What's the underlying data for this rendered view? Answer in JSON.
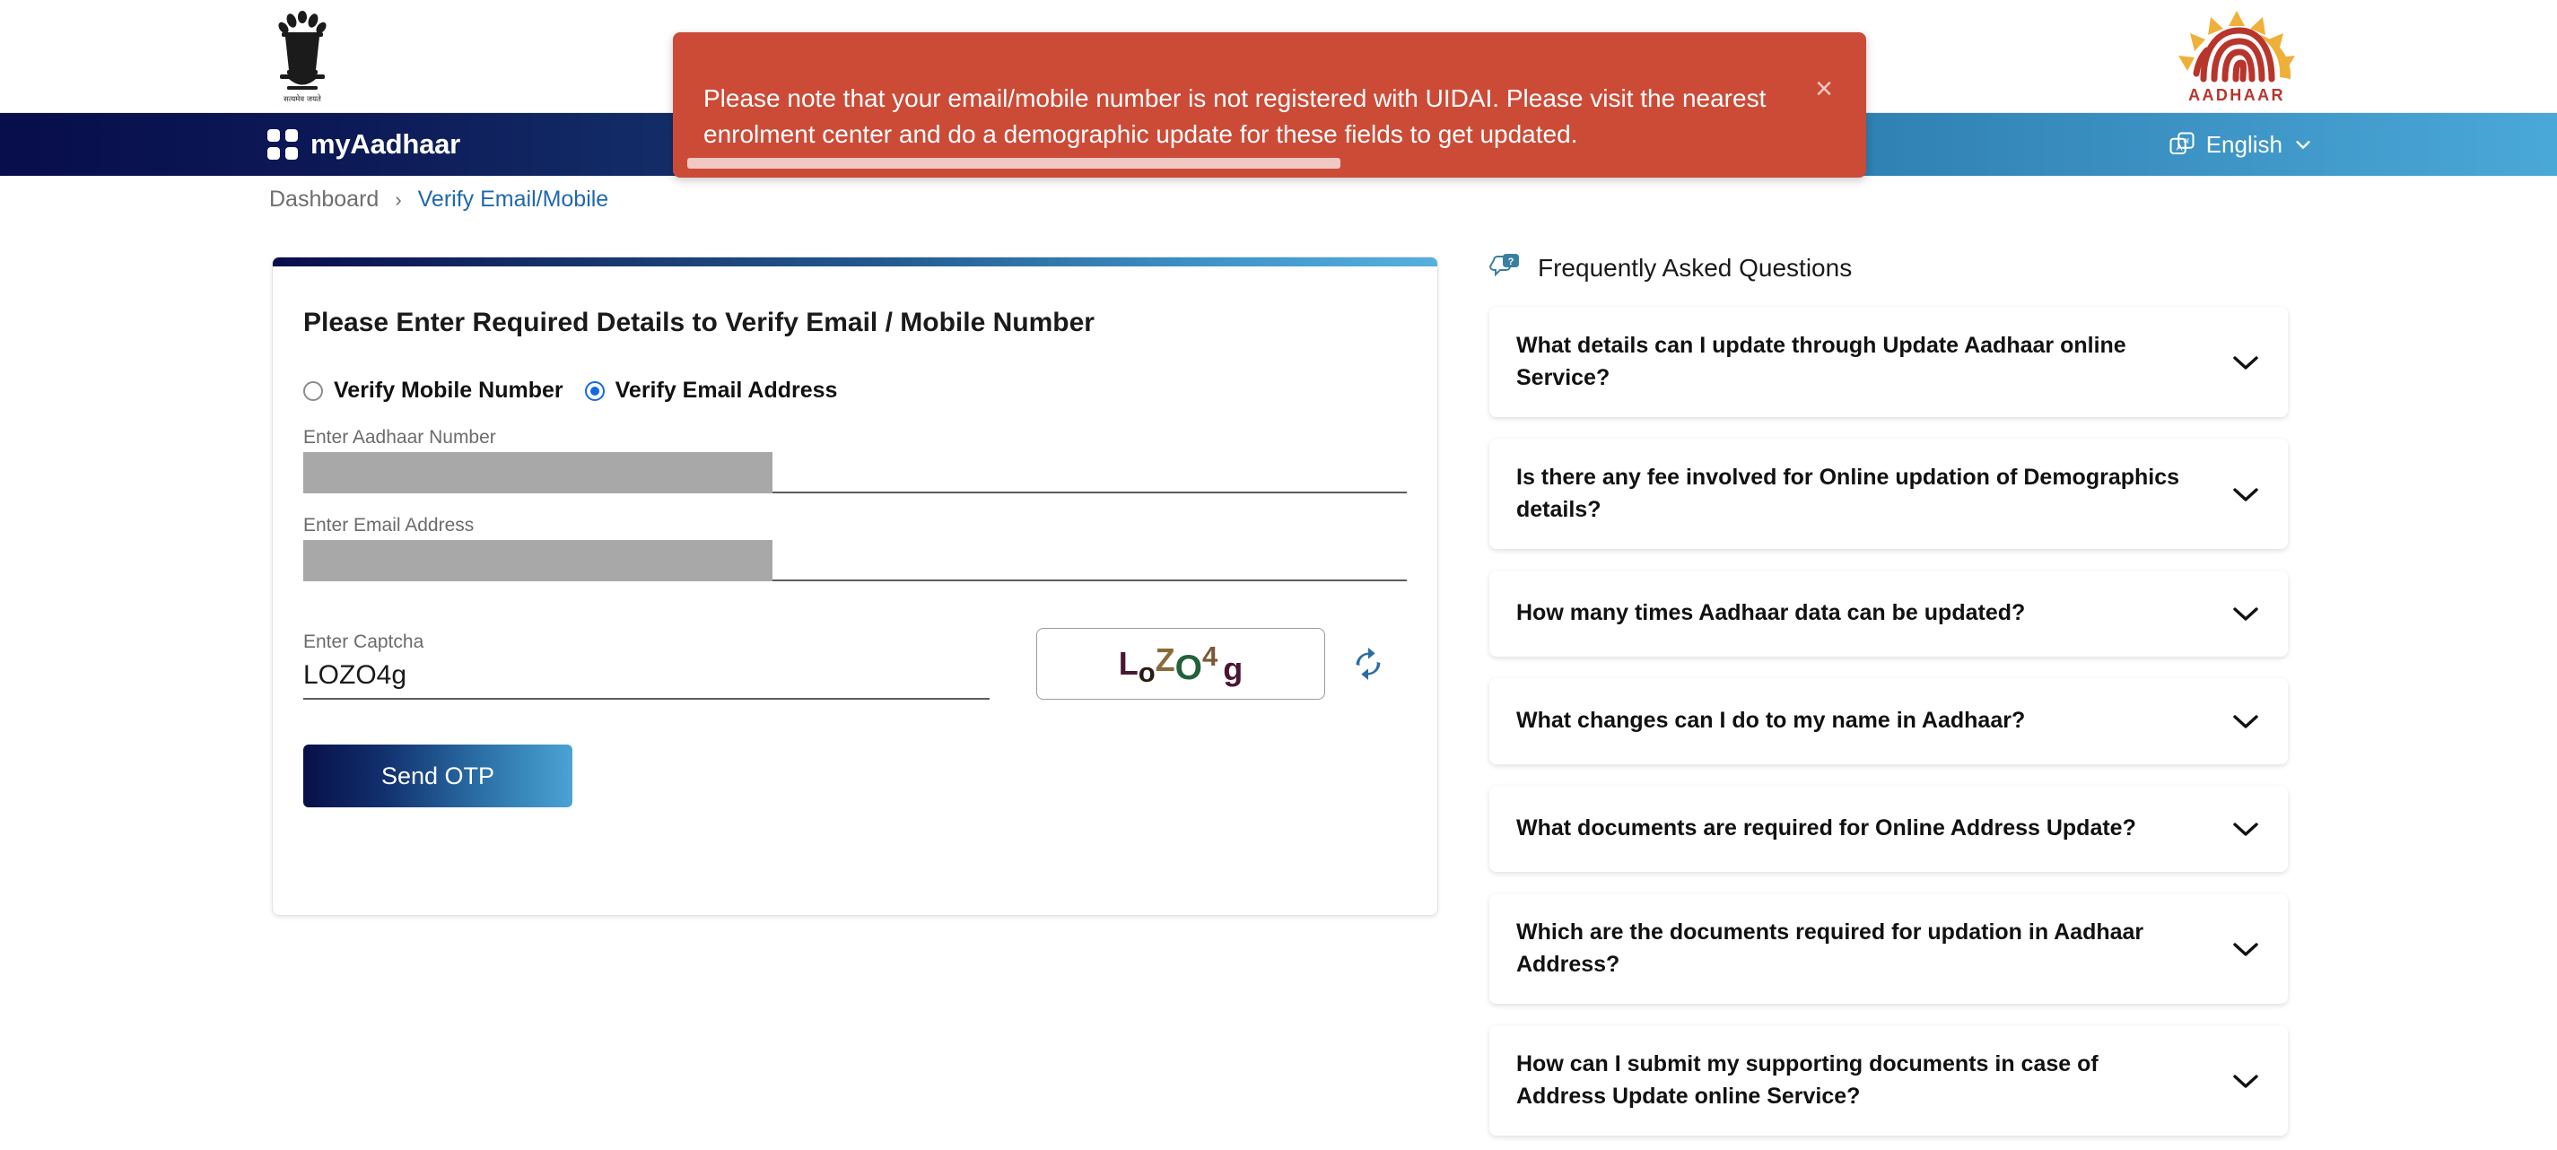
{
  "header": {
    "emblem_icon": "india-state-emblem",
    "emblem_caption": "सत्यमेव जयते",
    "aadhaar_logo_icon": "aadhaar-fingerprint-logo",
    "aadhaar_logo_text": "AADHAAR"
  },
  "navbar": {
    "brand": "myAadhaar",
    "brand_icon": "four-square-grid-icon",
    "language_icon": "translate-icon",
    "language": "English",
    "language_chevron_icon": "chevron-down-icon",
    "gradient_start": "#080d4b",
    "gradient_end": "#4aa8d8"
  },
  "breadcrumb": {
    "home": "Dashboard",
    "separator": "›",
    "current": "Verify Email/Mobile",
    "current_color": "#2068ad"
  },
  "toast": {
    "message": "Please note that your email/mobile number is not registered with UIDAI. Please visit the nearest enrolment center and do a demographic update for these fields to get updated.",
    "close_icon": "close-icon",
    "close_label": "×",
    "background": "#cc4b37",
    "progress_percent": 56,
    "progress_color": "#f0c9c2"
  },
  "form": {
    "title": "Please Enter Required Details to Verify Email / Mobile Number",
    "radios": [
      {
        "label": "Verify Mobile Number",
        "selected": false
      },
      {
        "label": "Verify Email Address",
        "selected": true
      }
    ],
    "aadhaar": {
      "label": "Enter Aadhaar Number",
      "value": "",
      "masked": true
    },
    "email": {
      "label": "Enter Email Address",
      "value": "",
      "masked": true
    },
    "captcha": {
      "label": "Enter Captcha",
      "value": "LOZO4g",
      "image_text": "LoZO4g",
      "image_chars": [
        "L",
        "o",
        "Z",
        "O",
        "4",
        "g"
      ],
      "refresh_icon": "refresh-icon"
    },
    "submit_label": "Send OTP",
    "accent_gradient_start": "#081048",
    "accent_gradient_end": "#4aa3d4"
  },
  "faq": {
    "icon": "chat-question-icon",
    "title": "Frequently Asked Questions",
    "chevron_icon": "chevron-down-icon",
    "items": [
      {
        "question": "What details can I update through Update Aadhaar online Service?"
      },
      {
        "question": "Is there any fee involved for Online updation of Demographics details?"
      },
      {
        "question": "How many times Aadhaar data can be updated?"
      },
      {
        "question": "What changes can I do to my name in Aadhaar?"
      },
      {
        "question": "What documents are required for Online Address Update?"
      },
      {
        "question": "Which are the documents required for updation in Aadhaar Address?"
      },
      {
        "question": "How can I submit my supporting documents in case of Address Update online Service?"
      }
    ]
  }
}
